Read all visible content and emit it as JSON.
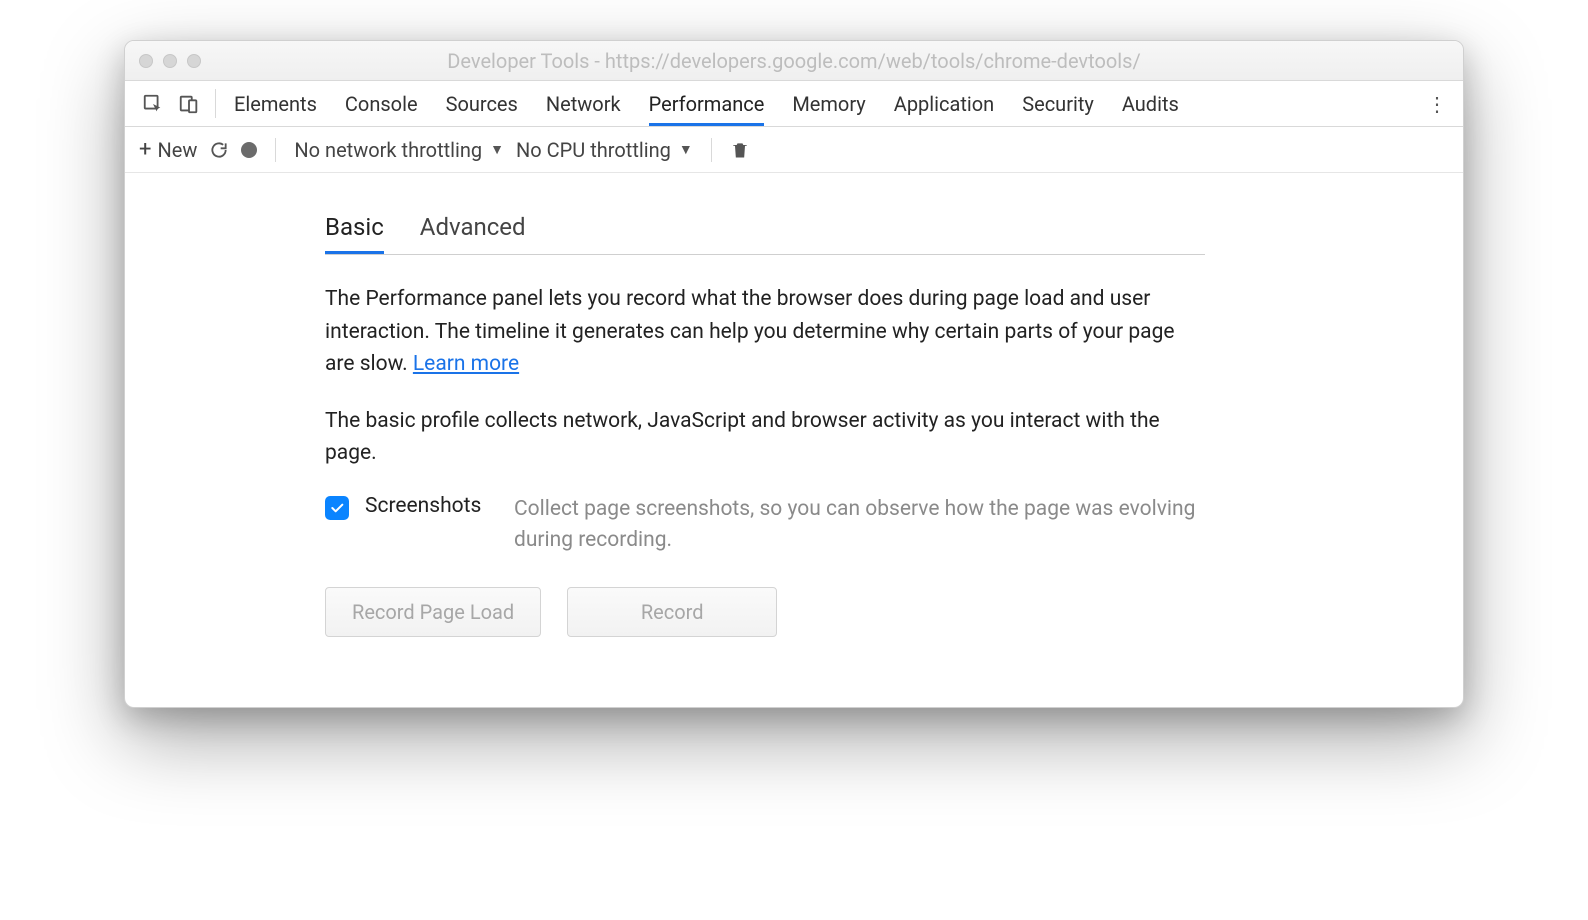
{
  "window": {
    "title": "Developer Tools - https://developers.google.com/web/tools/chrome-devtools/"
  },
  "devtools": {
    "tabs": [
      "Elements",
      "Console",
      "Sources",
      "Network",
      "Performance",
      "Memory",
      "Application",
      "Security",
      "Audits"
    ],
    "active_tab": "Performance"
  },
  "toolbar": {
    "new_label": "New",
    "network_throttle": "No network throttling",
    "cpu_throttle": "No CPU throttling"
  },
  "panel": {
    "subtabs": [
      "Basic",
      "Advanced"
    ],
    "active_subtab": "Basic",
    "para1_a": "The Performance panel lets you record what the browser does during page load and user interaction. The timeline it generates can help you determine why certain parts of your page are slow.  ",
    "learn_more": "Learn more",
    "para2": "The basic profile collects network, JavaScript and browser activity as you interact with the page.",
    "option": {
      "checked": true,
      "label": "Screenshots",
      "description": "Collect page screenshots, so you can observe how the page was evolving during recording."
    },
    "buttons": {
      "record_page_load": "Record Page Load",
      "record": "Record"
    }
  }
}
